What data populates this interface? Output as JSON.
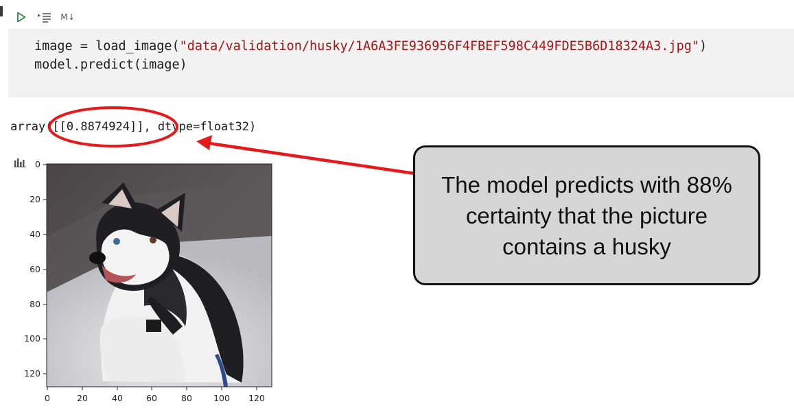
{
  "toolbar": {
    "run_icon": "play-icon",
    "run_by_line_icon": "run-by-line-icon",
    "markdown_label": "M↓"
  },
  "code": {
    "line1_prefix": "image = load_image(",
    "line1_string": "\"data/validation/husky/1A6A3FE936956F4FBEF598C449FDE5B6D18324A3.jpg\"",
    "line1_suffix": ")",
    "line2": "model.predict(image)"
  },
  "output": {
    "result_text": "array([[0.8874924]], dtype=float32)",
    "plot_icon": "bar-chart-icon"
  },
  "plot": {
    "y_ticks": [
      "0",
      "20",
      "40",
      "60",
      "80",
      "100",
      "120"
    ],
    "x_ticks": [
      "0",
      "20",
      "40",
      "60",
      "80",
      "100",
      "120"
    ],
    "image_description_icon": "husky-photo"
  },
  "annotation": {
    "callout_text": "The model predicts with 88% certainty that the picture contains a husky",
    "highlight_color": "#e8191b",
    "arrow_color": "#e8191b"
  },
  "colors": {
    "code_bg": "#f2f2f2",
    "string_color": "#a31515",
    "run_icon_color": "#2e8b3d",
    "callout_bg": "#d6d6d6"
  }
}
